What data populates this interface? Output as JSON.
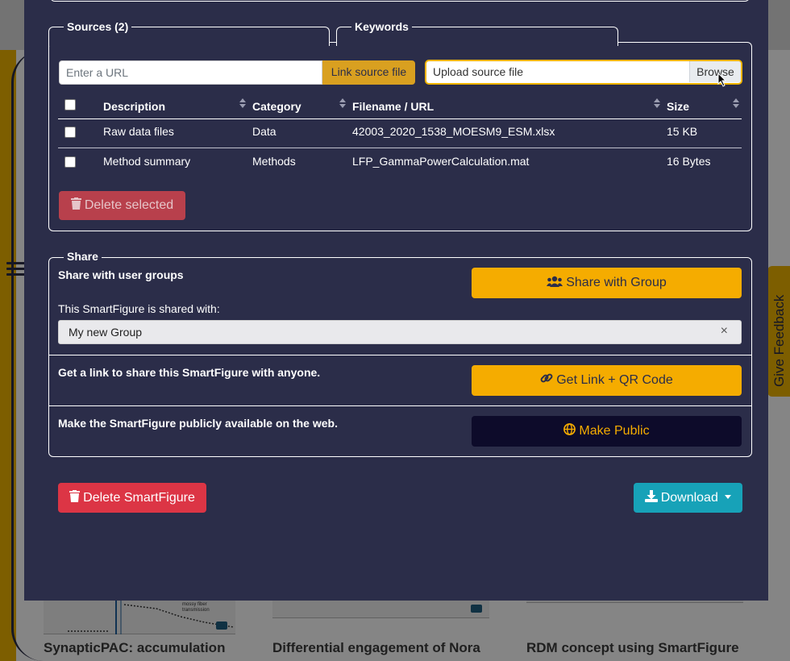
{
  "background": {
    "feedback_label": "Give Feedback",
    "cards": [
      {
        "title": "SynapticPAC: accumulation",
        "thumb_caption": "mossy fiber transmission"
      },
      {
        "title": "Differential engagement of Nora"
      },
      {
        "title": "RDM concept using SmartFigure"
      }
    ]
  },
  "sources": {
    "tab_label": "Sources (2)",
    "keywords_tab_label": "Keywords",
    "url_input_placeholder": "Enter a URL",
    "link_button_label": "Link source file",
    "upload_label": "Upload source file",
    "browse_label": "Browse",
    "columns": [
      "Description",
      "Category",
      "Filename / URL",
      "Size"
    ],
    "rows": [
      {
        "description": "Raw data files",
        "category": "Data",
        "filename": "42003_2020_1538_MOESM9_ESM.xlsx",
        "size": "15 KB"
      },
      {
        "description": "Method summary",
        "category": "Methods",
        "filename": "LFP_GammaPowerCalculation.mat",
        "size": "16 Bytes"
      }
    ],
    "delete_selected_label": "Delete selected"
  },
  "share": {
    "legend": "Share",
    "user_groups_label": "Share with user groups",
    "share_group_button": "Share with Group",
    "shared_with_label": "This SmartFigure is shared with:",
    "groups": [
      "My new Group"
    ],
    "link_text": "Get a link to share this SmartFigure with anyone.",
    "link_button": "Get Link + QR Code",
    "public_text": "Make the SmartFigure publicly available on the web.",
    "public_button": "Make Public"
  },
  "footer": {
    "delete_label": "Delete SmartFigure",
    "download_label": "Download"
  },
  "colors": {
    "modal_bg": "#2b2d49",
    "accent_yellow": "#f5ac00",
    "danger": "#dc3545",
    "info": "#17a2b8",
    "dark_button": "#0d0b2a"
  }
}
